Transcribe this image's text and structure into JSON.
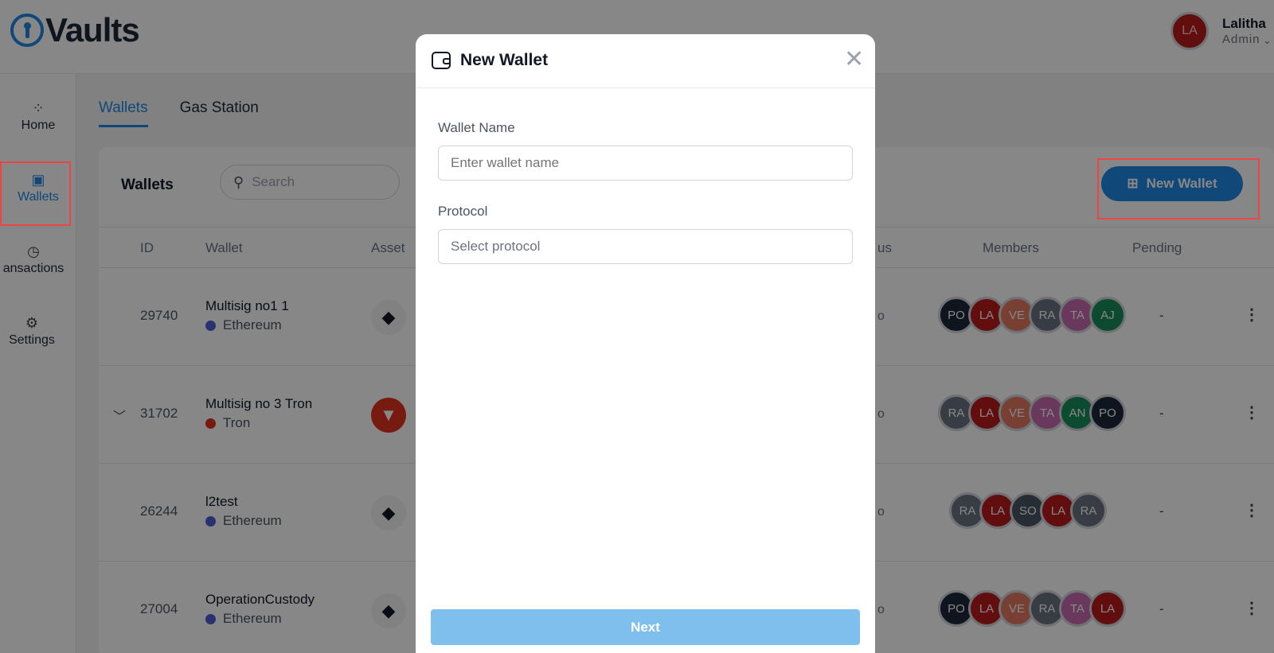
{
  "app": {
    "logo_text": "Vaults"
  },
  "user": {
    "initials": "LA",
    "name": "Lalitha",
    "role": "Admin"
  },
  "sidebar": {
    "items": [
      {
        "label": "Home",
        "icon": "grid-icon"
      },
      {
        "label": "Wallets",
        "icon": "wallet-icon"
      },
      {
        "label": "ansactions",
        "icon": "clock-icon"
      },
      {
        "label": "Settings",
        "icon": "gear-icon"
      }
    ]
  },
  "tabs": [
    "Wallets",
    "Gas Station"
  ],
  "card": {
    "title": "Wallets",
    "search_placeholder": "Search",
    "new_wallet_label": "New Wallet"
  },
  "table": {
    "headers": {
      "id": "ID",
      "wallet": "Wallet",
      "asset": "Asset",
      "status": "us",
      "members": "Members",
      "pending": "Pending"
    },
    "rows": [
      {
        "id": "29740",
        "name": "Multisig no1 1",
        "protocol": "Ethereum",
        "pending": "-",
        "members": [
          "PO",
          "LA",
          "VE",
          "RA",
          "TA",
          "AJ"
        ]
      },
      {
        "id": "31702",
        "name": "Multisig no 3 Tron",
        "protocol": "Tron",
        "pending": "-",
        "members": [
          "RA",
          "LA",
          "VE",
          "TA",
          "AN",
          "PO"
        ]
      },
      {
        "id": "26244",
        "name": "l2test",
        "protocol": "Ethereum",
        "pending": "-",
        "members": [
          "RA",
          "LA",
          "SO",
          "LA",
          "RA"
        ]
      },
      {
        "id": "27004",
        "name": "OperationCustody",
        "protocol": "Ethereum",
        "pending": "-",
        "members": [
          "PO",
          "LA",
          "VE",
          "RA",
          "TA",
          "LA"
        ]
      }
    ]
  },
  "modal": {
    "title": "New Wallet",
    "wallet_name_label": "Wallet Name",
    "wallet_name_placeholder": "Enter wallet name",
    "protocol_label": "Protocol",
    "protocol_placeholder": "Select protocol",
    "next_label": "Next"
  },
  "colors": {
    "accent": "#1e88e5",
    "highlight": "#ef4444",
    "ethereum": "#4f5fd6",
    "tron": "#e0311f"
  }
}
